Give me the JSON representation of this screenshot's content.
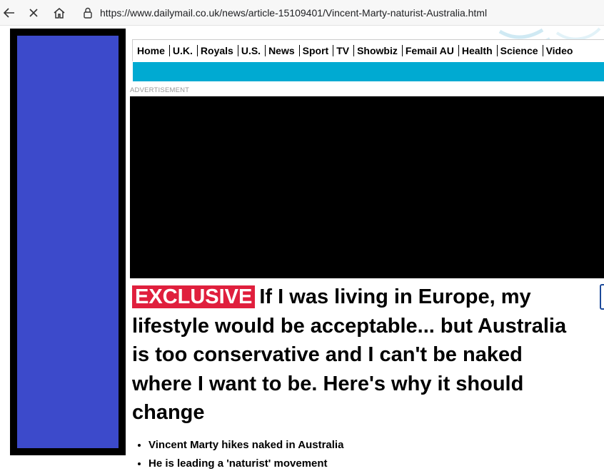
{
  "browser": {
    "url": "https://www.dailymail.co.uk/news/article-15109401/Vincent-Marty-naturist-Australia.html",
    "icons": [
      "back-arrow-icon",
      "close-icon",
      "home-icon",
      "site-info-icon"
    ]
  },
  "nav": {
    "items": [
      {
        "label": "Home"
      },
      {
        "label": "U.K."
      },
      {
        "label": "Royals"
      },
      {
        "label": "U.S."
      },
      {
        "label": "News"
      },
      {
        "label": "Sport"
      },
      {
        "label": "TV"
      },
      {
        "label": "Showbiz"
      },
      {
        "label": "Femail AU"
      },
      {
        "label": "Health"
      },
      {
        "label": "Science"
      },
      {
        "label": "Video"
      }
    ],
    "subnav_color": "#00aad2"
  },
  "ad": {
    "label": "ADVERTISEMENT"
  },
  "article": {
    "tag": "EXCLUSIVE",
    "tag_color": "#e01f3d",
    "headline": "If I was living in Europe, my lifestyle would be acceptable... but Australia is too conservative and I can't be naked where I want to be. Here's why it should change",
    "bullets": [
      "Vincent Marty hikes naked in Australia",
      "He is leading a 'naturist' movement"
    ]
  },
  "side_ad": {
    "color": "#3c4acb"
  }
}
